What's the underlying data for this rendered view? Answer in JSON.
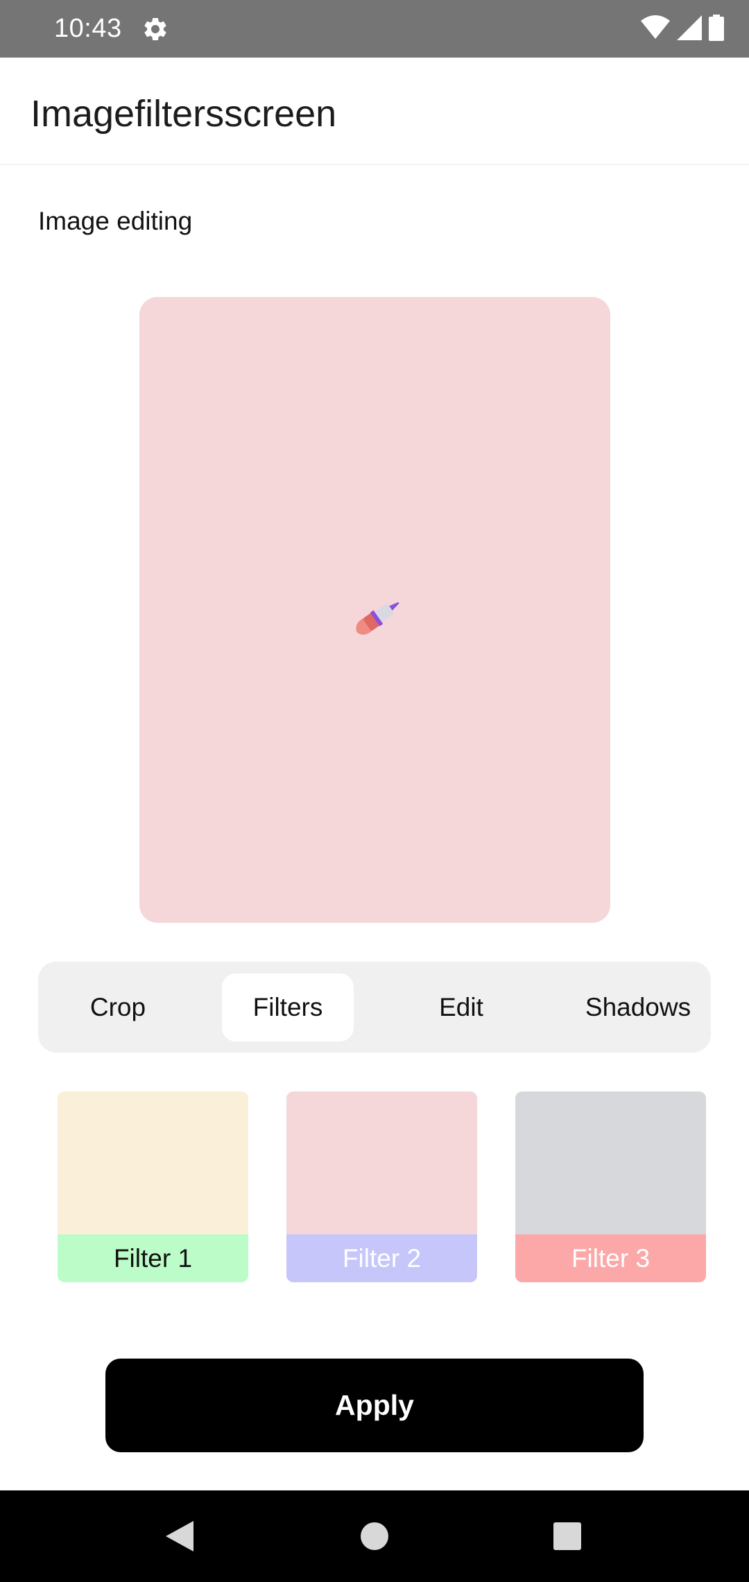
{
  "status_bar": {
    "time": "10:43",
    "icons": [
      "gear-icon",
      "wifi-icon",
      "cellular-signal-icon",
      "battery-icon"
    ]
  },
  "app_bar": {
    "title": "Imagefiltersscreen"
  },
  "section_title": "Image editing",
  "preview": {
    "background": "#f5d7d9",
    "icon": "paintbrush-icon"
  },
  "tabs": [
    {
      "label": "Crop",
      "active": false
    },
    {
      "label": "Filters",
      "active": true
    },
    {
      "label": "Edit",
      "active": false
    },
    {
      "label": "Shadows",
      "active": false
    }
  ],
  "filters": [
    {
      "label": "Filter 1",
      "swatch_color": "#faefd8",
      "label_bg": "#bcfcc9",
      "label_color": "#111111"
    },
    {
      "label": "Filter 2",
      "swatch_color": "#f5d7d9",
      "label_bg": "#c6c6fa",
      "label_color": "#ffffff"
    },
    {
      "label": "Filter 3",
      "swatch_color": "#d7d8db",
      "label_bg": "#fca8a8",
      "label_color": "#ffffff"
    }
  ],
  "apply_button": {
    "label": "Apply"
  },
  "nav_bar": {
    "icons": [
      "back-icon",
      "home-icon",
      "recents-icon"
    ]
  }
}
